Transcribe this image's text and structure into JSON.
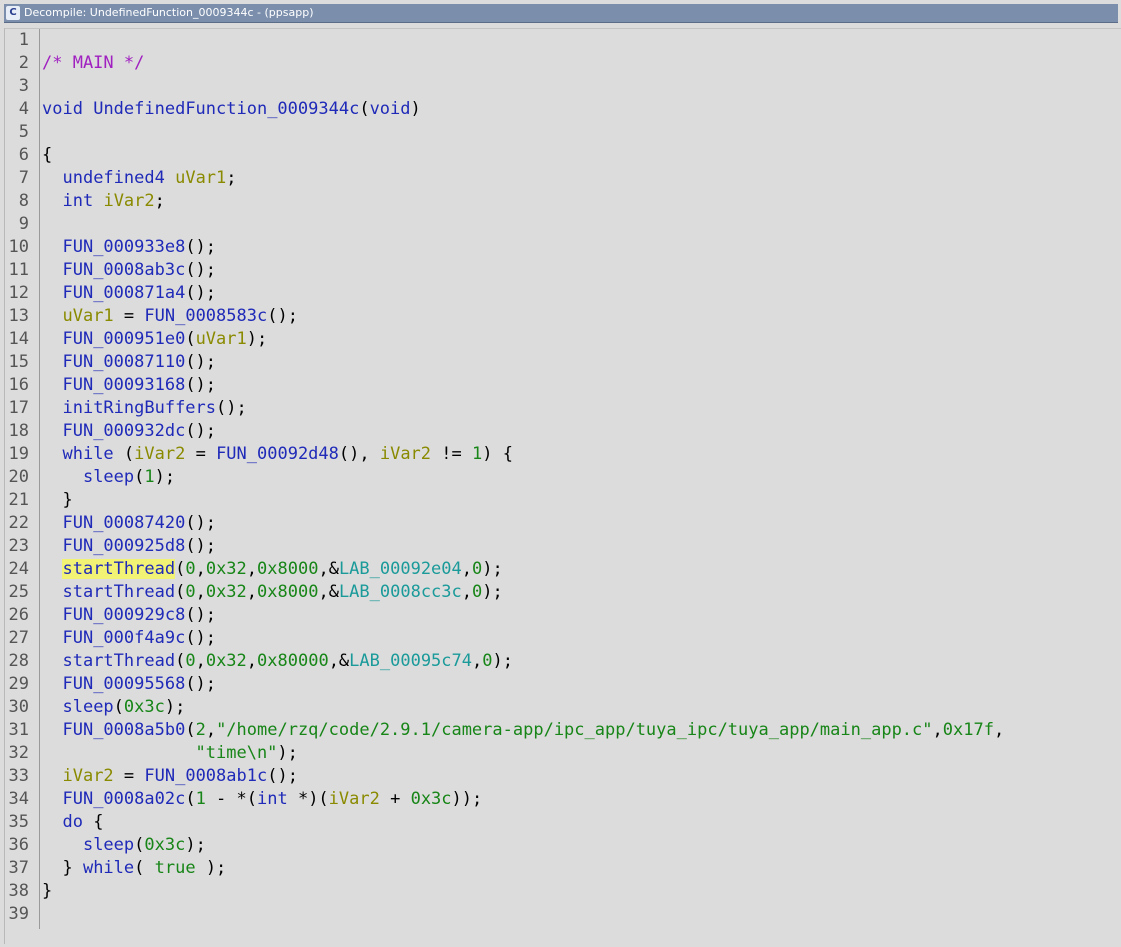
{
  "window": {
    "title": "Decompile: UndefinedFunction_0009344c -  (ppsapp)",
    "icon": "decompiler-icon"
  },
  "colors": {
    "keyword": "#1f2ab8",
    "variable": "#8a8a00",
    "number": "#178517",
    "label": "#1b9a9a",
    "comment": "#a020c0",
    "highlight": "#f2f275"
  },
  "lines": [
    {
      "n": "1",
      "tokens": []
    },
    {
      "n": "2",
      "tokens": [
        {
          "t": "/* MAIN */",
          "c": "c"
        }
      ]
    },
    {
      "n": "3",
      "tokens": []
    },
    {
      "n": "4",
      "tokens": [
        {
          "t": "void",
          "c": "t"
        },
        {
          "t": " ",
          "c": "p"
        },
        {
          "t": "UndefinedFunction_0009344c",
          "c": "f"
        },
        {
          "t": "(",
          "c": "p"
        },
        {
          "t": "void",
          "c": "t"
        },
        {
          "t": ")",
          "c": "p"
        }
      ]
    },
    {
      "n": "5",
      "tokens": []
    },
    {
      "n": "6",
      "tokens": [
        {
          "t": "{",
          "c": "p"
        }
      ]
    },
    {
      "n": "7",
      "tokens": [
        {
          "t": "  ",
          "c": "p"
        },
        {
          "t": "undefined4",
          "c": "t"
        },
        {
          "t": " ",
          "c": "p"
        },
        {
          "t": "uVar1",
          "c": "v"
        },
        {
          "t": ";",
          "c": "p"
        }
      ]
    },
    {
      "n": "8",
      "tokens": [
        {
          "t": "  ",
          "c": "p"
        },
        {
          "t": "int",
          "c": "t"
        },
        {
          "t": " ",
          "c": "p"
        },
        {
          "t": "iVar2",
          "c": "v"
        },
        {
          "t": ";",
          "c": "p"
        }
      ]
    },
    {
      "n": "9",
      "tokens": []
    },
    {
      "n": "10",
      "tokens": [
        {
          "t": "  ",
          "c": "p"
        },
        {
          "t": "FUN_000933e8",
          "c": "f"
        },
        {
          "t": "();",
          "c": "p"
        }
      ]
    },
    {
      "n": "11",
      "tokens": [
        {
          "t": "  ",
          "c": "p"
        },
        {
          "t": "FUN_0008ab3c",
          "c": "f"
        },
        {
          "t": "();",
          "c": "p"
        }
      ]
    },
    {
      "n": "12",
      "tokens": [
        {
          "t": "  ",
          "c": "p"
        },
        {
          "t": "FUN_000871a4",
          "c": "f"
        },
        {
          "t": "();",
          "c": "p"
        }
      ]
    },
    {
      "n": "13",
      "tokens": [
        {
          "t": "  ",
          "c": "p"
        },
        {
          "t": "uVar1",
          "c": "v"
        },
        {
          "t": " = ",
          "c": "p"
        },
        {
          "t": "FUN_0008583c",
          "c": "f"
        },
        {
          "t": "();",
          "c": "p"
        }
      ]
    },
    {
      "n": "14",
      "tokens": [
        {
          "t": "  ",
          "c": "p"
        },
        {
          "t": "FUN_000951e0",
          "c": "f"
        },
        {
          "t": "(",
          "c": "p"
        },
        {
          "t": "uVar1",
          "c": "v"
        },
        {
          "t": ");",
          "c": "p"
        }
      ]
    },
    {
      "n": "15",
      "tokens": [
        {
          "t": "  ",
          "c": "p"
        },
        {
          "t": "FUN_00087110",
          "c": "f"
        },
        {
          "t": "();",
          "c": "p"
        }
      ]
    },
    {
      "n": "16",
      "tokens": [
        {
          "t": "  ",
          "c": "p"
        },
        {
          "t": "FUN_00093168",
          "c": "f"
        },
        {
          "t": "();",
          "c": "p"
        }
      ]
    },
    {
      "n": "17",
      "tokens": [
        {
          "t": "  ",
          "c": "p"
        },
        {
          "t": "initRingBuffers",
          "c": "f"
        },
        {
          "t": "();",
          "c": "p"
        }
      ]
    },
    {
      "n": "18",
      "tokens": [
        {
          "t": "  ",
          "c": "p"
        },
        {
          "t": "FUN_000932dc",
          "c": "f"
        },
        {
          "t": "();",
          "c": "p"
        }
      ]
    },
    {
      "n": "19",
      "tokens": [
        {
          "t": "  ",
          "c": "p"
        },
        {
          "t": "while",
          "c": "k"
        },
        {
          "t": " (",
          "c": "p"
        },
        {
          "t": "iVar2",
          "c": "v"
        },
        {
          "t": " = ",
          "c": "p"
        },
        {
          "t": "FUN_00092d48",
          "c": "f"
        },
        {
          "t": "(), ",
          "c": "p"
        },
        {
          "t": "iVar2",
          "c": "v"
        },
        {
          "t": " != ",
          "c": "p"
        },
        {
          "t": "1",
          "c": "n"
        },
        {
          "t": ") {",
          "c": "p"
        }
      ]
    },
    {
      "n": "20",
      "tokens": [
        {
          "t": "    ",
          "c": "p"
        },
        {
          "t": "sleep",
          "c": "f"
        },
        {
          "t": "(",
          "c": "p"
        },
        {
          "t": "1",
          "c": "n"
        },
        {
          "t": ");",
          "c": "p"
        }
      ]
    },
    {
      "n": "21",
      "tokens": [
        {
          "t": "  }",
          "c": "p"
        }
      ]
    },
    {
      "n": "22",
      "tokens": [
        {
          "t": "  ",
          "c": "p"
        },
        {
          "t": "FUN_00087420",
          "c": "f"
        },
        {
          "t": "();",
          "c": "p"
        }
      ]
    },
    {
      "n": "23",
      "tokens": [
        {
          "t": "  ",
          "c": "p"
        },
        {
          "t": "FUN_000925d8",
          "c": "f"
        },
        {
          "t": "();",
          "c": "p"
        }
      ]
    },
    {
      "n": "24",
      "tokens": [
        {
          "t": "  ",
          "c": "p"
        },
        {
          "t": "startThread",
          "c": "f hl"
        },
        {
          "t": "(",
          "c": "p"
        },
        {
          "t": "0",
          "c": "n"
        },
        {
          "t": ",",
          "c": "p"
        },
        {
          "t": "0x32",
          "c": "n"
        },
        {
          "t": ",",
          "c": "p"
        },
        {
          "t": "0x8000",
          "c": "n"
        },
        {
          "t": ",&",
          "c": "p"
        },
        {
          "t": "LAB_00092e04",
          "c": "l"
        },
        {
          "t": ",",
          "c": "p"
        },
        {
          "t": "0",
          "c": "n"
        },
        {
          "t": ");",
          "c": "p"
        }
      ]
    },
    {
      "n": "25",
      "tokens": [
        {
          "t": "  ",
          "c": "p"
        },
        {
          "t": "startThread",
          "c": "f"
        },
        {
          "t": "(",
          "c": "p"
        },
        {
          "t": "0",
          "c": "n"
        },
        {
          "t": ",",
          "c": "p"
        },
        {
          "t": "0x32",
          "c": "n"
        },
        {
          "t": ",",
          "c": "p"
        },
        {
          "t": "0x8000",
          "c": "n"
        },
        {
          "t": ",&",
          "c": "p"
        },
        {
          "t": "LAB_0008cc3c",
          "c": "l"
        },
        {
          "t": ",",
          "c": "p"
        },
        {
          "t": "0",
          "c": "n"
        },
        {
          "t": ");",
          "c": "p"
        }
      ]
    },
    {
      "n": "26",
      "tokens": [
        {
          "t": "  ",
          "c": "p"
        },
        {
          "t": "FUN_000929c8",
          "c": "f"
        },
        {
          "t": "();",
          "c": "p"
        }
      ]
    },
    {
      "n": "27",
      "tokens": [
        {
          "t": "  ",
          "c": "p"
        },
        {
          "t": "FUN_000f4a9c",
          "c": "f"
        },
        {
          "t": "();",
          "c": "p"
        }
      ]
    },
    {
      "n": "28",
      "tokens": [
        {
          "t": "  ",
          "c": "p"
        },
        {
          "t": "startThread",
          "c": "f"
        },
        {
          "t": "(",
          "c": "p"
        },
        {
          "t": "0",
          "c": "n"
        },
        {
          "t": ",",
          "c": "p"
        },
        {
          "t": "0x32",
          "c": "n"
        },
        {
          "t": ",",
          "c": "p"
        },
        {
          "t": "0x80000",
          "c": "n"
        },
        {
          "t": ",&",
          "c": "p"
        },
        {
          "t": "LAB_00095c74",
          "c": "l"
        },
        {
          "t": ",",
          "c": "p"
        },
        {
          "t": "0",
          "c": "n"
        },
        {
          "t": ");",
          "c": "p"
        }
      ]
    },
    {
      "n": "29",
      "tokens": [
        {
          "t": "  ",
          "c": "p"
        },
        {
          "t": "FUN_00095568",
          "c": "f"
        },
        {
          "t": "();",
          "c": "p"
        }
      ]
    },
    {
      "n": "30",
      "tokens": [
        {
          "t": "  ",
          "c": "p"
        },
        {
          "t": "sleep",
          "c": "f"
        },
        {
          "t": "(",
          "c": "p"
        },
        {
          "t": "0x3c",
          "c": "n"
        },
        {
          "t": ");",
          "c": "p"
        }
      ]
    },
    {
      "n": "31",
      "tokens": [
        {
          "t": "  ",
          "c": "p"
        },
        {
          "t": "FUN_0008a5b0",
          "c": "f"
        },
        {
          "t": "(",
          "c": "p"
        },
        {
          "t": "2",
          "c": "n"
        },
        {
          "t": ",",
          "c": "p"
        },
        {
          "t": "\"/home/rzq/code/2.9.1/camera-app/ipc_app/tuya_ipc/tuya_app/main_app.c\"",
          "c": "s"
        },
        {
          "t": ",",
          "c": "p"
        },
        {
          "t": "0x17f",
          "c": "n"
        },
        {
          "t": ",",
          "c": "p"
        }
      ]
    },
    {
      "n": "32",
      "tokens": [
        {
          "t": "               ",
          "c": "p"
        },
        {
          "t": "\"time\\n\"",
          "c": "s"
        },
        {
          "t": ");",
          "c": "p"
        }
      ]
    },
    {
      "n": "33",
      "tokens": [
        {
          "t": "  ",
          "c": "p"
        },
        {
          "t": "iVar2",
          "c": "v"
        },
        {
          "t": " = ",
          "c": "p"
        },
        {
          "t": "FUN_0008ab1c",
          "c": "f"
        },
        {
          "t": "();",
          "c": "p"
        }
      ]
    },
    {
      "n": "34",
      "tokens": [
        {
          "t": "  ",
          "c": "p"
        },
        {
          "t": "FUN_0008a02c",
          "c": "f"
        },
        {
          "t": "(",
          "c": "p"
        },
        {
          "t": "1",
          "c": "n"
        },
        {
          "t": " - *(",
          "c": "p"
        },
        {
          "t": "int",
          "c": "t"
        },
        {
          "t": " *)(",
          "c": "p"
        },
        {
          "t": "iVar2",
          "c": "v"
        },
        {
          "t": " + ",
          "c": "p"
        },
        {
          "t": "0x3c",
          "c": "n"
        },
        {
          "t": "));",
          "c": "p"
        }
      ]
    },
    {
      "n": "35",
      "tokens": [
        {
          "t": "  ",
          "c": "p"
        },
        {
          "t": "do",
          "c": "k"
        },
        {
          "t": " {",
          "c": "p"
        }
      ]
    },
    {
      "n": "36",
      "tokens": [
        {
          "t": "    ",
          "c": "p"
        },
        {
          "t": "sleep",
          "c": "f"
        },
        {
          "t": "(",
          "c": "p"
        },
        {
          "t": "0x3c",
          "c": "n"
        },
        {
          "t": ");",
          "c": "p"
        }
      ]
    },
    {
      "n": "37",
      "tokens": [
        {
          "t": "  } ",
          "c": "p"
        },
        {
          "t": "while",
          "c": "k"
        },
        {
          "t": "( ",
          "c": "p"
        },
        {
          "t": "true",
          "c": "n"
        },
        {
          "t": " );",
          "c": "p"
        }
      ]
    },
    {
      "n": "38",
      "tokens": [
        {
          "t": "}",
          "c": "p"
        }
      ]
    },
    {
      "n": "39",
      "tokens": []
    }
  ]
}
